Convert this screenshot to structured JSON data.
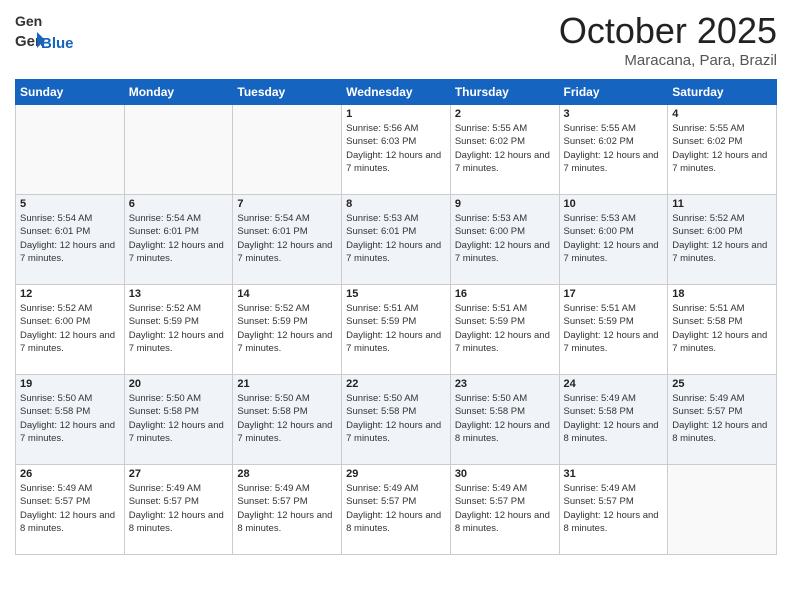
{
  "header": {
    "logo_general": "General",
    "logo_blue": "Blue",
    "month": "October 2025",
    "location": "Maracana, Para, Brazil"
  },
  "weekdays": [
    "Sunday",
    "Monday",
    "Tuesday",
    "Wednesday",
    "Thursday",
    "Friday",
    "Saturday"
  ],
  "rows": [
    [
      {
        "day": "",
        "sunrise": "",
        "sunset": "",
        "daylight": "",
        "empty": true
      },
      {
        "day": "",
        "sunrise": "",
        "sunset": "",
        "daylight": "",
        "empty": true
      },
      {
        "day": "",
        "sunrise": "",
        "sunset": "",
        "daylight": "",
        "empty": true
      },
      {
        "day": "1",
        "sunrise": "Sunrise: 5:56 AM",
        "sunset": "Sunset: 6:03 PM",
        "daylight": "Daylight: 12 hours and 7 minutes."
      },
      {
        "day": "2",
        "sunrise": "Sunrise: 5:55 AM",
        "sunset": "Sunset: 6:02 PM",
        "daylight": "Daylight: 12 hours and 7 minutes."
      },
      {
        "day": "3",
        "sunrise": "Sunrise: 5:55 AM",
        "sunset": "Sunset: 6:02 PM",
        "daylight": "Daylight: 12 hours and 7 minutes."
      },
      {
        "day": "4",
        "sunrise": "Sunrise: 5:55 AM",
        "sunset": "Sunset: 6:02 PM",
        "daylight": "Daylight: 12 hours and 7 minutes."
      }
    ],
    [
      {
        "day": "5",
        "sunrise": "Sunrise: 5:54 AM",
        "sunset": "Sunset: 6:01 PM",
        "daylight": "Daylight: 12 hours and 7 minutes."
      },
      {
        "day": "6",
        "sunrise": "Sunrise: 5:54 AM",
        "sunset": "Sunset: 6:01 PM",
        "daylight": "Daylight: 12 hours and 7 minutes."
      },
      {
        "day": "7",
        "sunrise": "Sunrise: 5:54 AM",
        "sunset": "Sunset: 6:01 PM",
        "daylight": "Daylight: 12 hours and 7 minutes."
      },
      {
        "day": "8",
        "sunrise": "Sunrise: 5:53 AM",
        "sunset": "Sunset: 6:01 PM",
        "daylight": "Daylight: 12 hours and 7 minutes."
      },
      {
        "day": "9",
        "sunrise": "Sunrise: 5:53 AM",
        "sunset": "Sunset: 6:00 PM",
        "daylight": "Daylight: 12 hours and 7 minutes."
      },
      {
        "day": "10",
        "sunrise": "Sunrise: 5:53 AM",
        "sunset": "Sunset: 6:00 PM",
        "daylight": "Daylight: 12 hours and 7 minutes."
      },
      {
        "day": "11",
        "sunrise": "Sunrise: 5:52 AM",
        "sunset": "Sunset: 6:00 PM",
        "daylight": "Daylight: 12 hours and 7 minutes."
      }
    ],
    [
      {
        "day": "12",
        "sunrise": "Sunrise: 5:52 AM",
        "sunset": "Sunset: 6:00 PM",
        "daylight": "Daylight: 12 hours and 7 minutes."
      },
      {
        "day": "13",
        "sunrise": "Sunrise: 5:52 AM",
        "sunset": "Sunset: 5:59 PM",
        "daylight": "Daylight: 12 hours and 7 minutes."
      },
      {
        "day": "14",
        "sunrise": "Sunrise: 5:52 AM",
        "sunset": "Sunset: 5:59 PM",
        "daylight": "Daylight: 12 hours and 7 minutes."
      },
      {
        "day": "15",
        "sunrise": "Sunrise: 5:51 AM",
        "sunset": "Sunset: 5:59 PM",
        "daylight": "Daylight: 12 hours and 7 minutes."
      },
      {
        "day": "16",
        "sunrise": "Sunrise: 5:51 AM",
        "sunset": "Sunset: 5:59 PM",
        "daylight": "Daylight: 12 hours and 7 minutes."
      },
      {
        "day": "17",
        "sunrise": "Sunrise: 5:51 AM",
        "sunset": "Sunset: 5:59 PM",
        "daylight": "Daylight: 12 hours and 7 minutes."
      },
      {
        "day": "18",
        "sunrise": "Sunrise: 5:51 AM",
        "sunset": "Sunset: 5:58 PM",
        "daylight": "Daylight: 12 hours and 7 minutes."
      }
    ],
    [
      {
        "day": "19",
        "sunrise": "Sunrise: 5:50 AM",
        "sunset": "Sunset: 5:58 PM",
        "daylight": "Daylight: 12 hours and 7 minutes."
      },
      {
        "day": "20",
        "sunrise": "Sunrise: 5:50 AM",
        "sunset": "Sunset: 5:58 PM",
        "daylight": "Daylight: 12 hours and 7 minutes."
      },
      {
        "day": "21",
        "sunrise": "Sunrise: 5:50 AM",
        "sunset": "Sunset: 5:58 PM",
        "daylight": "Daylight: 12 hours and 7 minutes."
      },
      {
        "day": "22",
        "sunrise": "Sunrise: 5:50 AM",
        "sunset": "Sunset: 5:58 PM",
        "daylight": "Daylight: 12 hours and 7 minutes."
      },
      {
        "day": "23",
        "sunrise": "Sunrise: 5:50 AM",
        "sunset": "Sunset: 5:58 PM",
        "daylight": "Daylight: 12 hours and 8 minutes."
      },
      {
        "day": "24",
        "sunrise": "Sunrise: 5:49 AM",
        "sunset": "Sunset: 5:58 PM",
        "daylight": "Daylight: 12 hours and 8 minutes."
      },
      {
        "day": "25",
        "sunrise": "Sunrise: 5:49 AM",
        "sunset": "Sunset: 5:57 PM",
        "daylight": "Daylight: 12 hours and 8 minutes."
      }
    ],
    [
      {
        "day": "26",
        "sunrise": "Sunrise: 5:49 AM",
        "sunset": "Sunset: 5:57 PM",
        "daylight": "Daylight: 12 hours and 8 minutes."
      },
      {
        "day": "27",
        "sunrise": "Sunrise: 5:49 AM",
        "sunset": "Sunset: 5:57 PM",
        "daylight": "Daylight: 12 hours and 8 minutes."
      },
      {
        "day": "28",
        "sunrise": "Sunrise: 5:49 AM",
        "sunset": "Sunset: 5:57 PM",
        "daylight": "Daylight: 12 hours and 8 minutes."
      },
      {
        "day": "29",
        "sunrise": "Sunrise: 5:49 AM",
        "sunset": "Sunset: 5:57 PM",
        "daylight": "Daylight: 12 hours and 8 minutes."
      },
      {
        "day": "30",
        "sunrise": "Sunrise: 5:49 AM",
        "sunset": "Sunset: 5:57 PM",
        "daylight": "Daylight: 12 hours and 8 minutes."
      },
      {
        "day": "31",
        "sunrise": "Sunrise: 5:49 AM",
        "sunset": "Sunset: 5:57 PM",
        "daylight": "Daylight: 12 hours and 8 minutes."
      },
      {
        "day": "",
        "sunrise": "",
        "sunset": "",
        "daylight": "",
        "empty": true
      }
    ]
  ]
}
